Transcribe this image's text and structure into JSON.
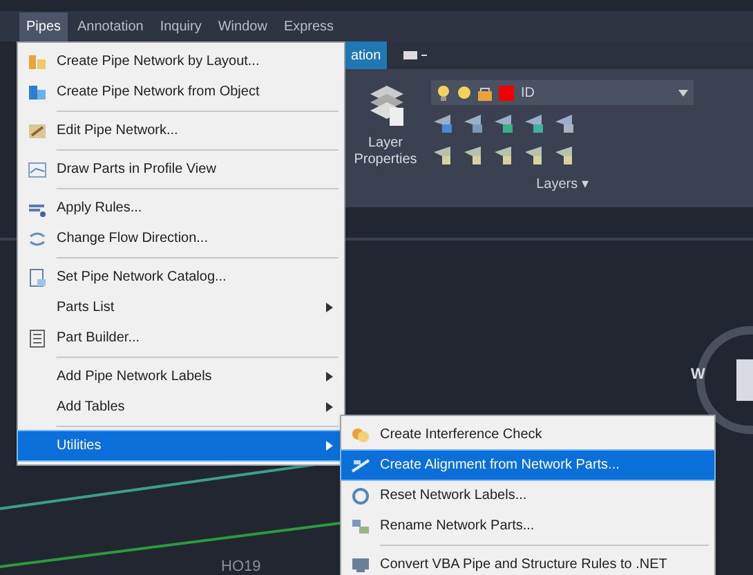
{
  "menubar": [
    {
      "label": "Pipes",
      "selected": true
    },
    {
      "label": "Annotation",
      "selected": false
    },
    {
      "label": "Inquiry",
      "selected": false
    },
    {
      "label": "Window",
      "selected": false
    },
    {
      "label": "Express",
      "selected": false
    }
  ],
  "ribbon": {
    "tab": "ation",
    "layer_button": "Layer Properties",
    "layer_name": "ID",
    "panel_title": "Layers ▾"
  },
  "pipes_menu": [
    [
      {
        "label": "Create Pipe Network by Layout...",
        "submenu": false,
        "selected": false
      },
      {
        "label": "Create Pipe Network from Object",
        "submenu": false,
        "selected": false
      }
    ],
    [
      {
        "label": "Edit Pipe Network...",
        "submenu": false,
        "selected": false
      }
    ],
    [
      {
        "label": "Draw Parts in Profile View",
        "submenu": false,
        "selected": false
      }
    ],
    [
      {
        "label": "Apply Rules...",
        "submenu": false,
        "selected": false
      },
      {
        "label": "Change Flow Direction...",
        "submenu": false,
        "selected": false
      }
    ],
    [
      {
        "label": "Set Pipe Network Catalog...",
        "submenu": false,
        "selected": false
      },
      {
        "label": "Parts List",
        "submenu": true,
        "selected": false
      },
      {
        "label": "Part Builder...",
        "submenu": false,
        "selected": false
      }
    ],
    [
      {
        "label": "Add Pipe Network Labels",
        "submenu": true,
        "selected": false
      },
      {
        "label": "Add Tables",
        "submenu": true,
        "selected": false
      }
    ],
    [
      {
        "label": "Utilities",
        "submenu": true,
        "selected": true
      }
    ]
  ],
  "utilities_menu": [
    [
      {
        "label": "Create Interference Check",
        "selected": false
      },
      {
        "label": "Create Alignment from Network Parts...",
        "selected": true
      },
      {
        "label": "Reset Network Labels...",
        "selected": false
      },
      {
        "label": "Rename Network Parts...",
        "selected": false
      }
    ],
    [
      {
        "label": "Convert VBA Pipe and Structure Rules to .NET",
        "selected": false
      }
    ]
  ],
  "drawing": {
    "compass_label": "W",
    "node_label": "HO19"
  }
}
